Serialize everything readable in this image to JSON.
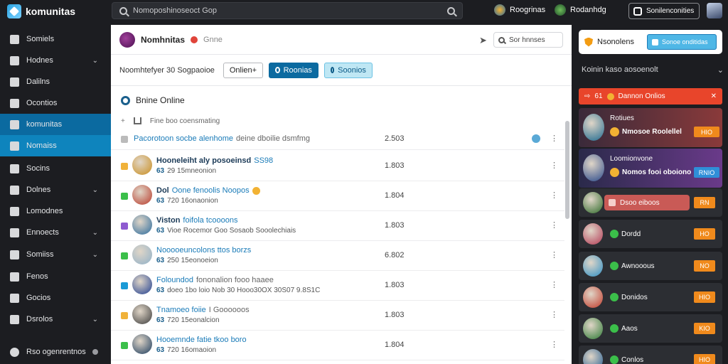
{
  "colors": {
    "accent_blue": "#0b6aa0",
    "orange": "#f08a1c",
    "alert_red": "#e8452b",
    "dark_bg": "#1c1d21"
  },
  "topbar": {
    "brand": "komunitas",
    "search_text": "Nomoposhinoseoct Gop",
    "user1_name": "Roogrinas",
    "user2_name": "Rodanhdg",
    "button_label": "Sonilenconities"
  },
  "sidebar": {
    "items": [
      {
        "label": "Somiels",
        "icon": "grid-icon",
        "chevron": false
      },
      {
        "label": "Hodnes",
        "icon": "globe-icon",
        "chevron": true
      },
      {
        "label": "Dalilns",
        "icon": "book-icon",
        "chevron": false
      },
      {
        "label": "Ocontios",
        "icon": "star-icon",
        "chevron": false
      },
      {
        "label": "komunitas",
        "icon": "community-icon",
        "chevron": false,
        "active": true
      },
      {
        "label": "Nomaiss",
        "icon": "people-icon",
        "chevron": false,
        "active2": true
      },
      {
        "label": "Socins",
        "icon": "user-icon",
        "chevron": false
      },
      {
        "label": "Dolnes",
        "icon": "folder-icon",
        "chevron": true
      },
      {
        "label": "Lomodnes",
        "icon": "group-icon",
        "chevron": false
      },
      {
        "label": "Ennoects",
        "icon": "building-icon",
        "chevron": true
      },
      {
        "label": "Somiiss",
        "icon": "chart-icon",
        "chevron": true
      },
      {
        "label": "Fenos",
        "icon": "list-icon",
        "chevron": false
      },
      {
        "label": "Gocios",
        "icon": "location-icon",
        "chevron": false
      },
      {
        "label": "Dsrolos",
        "icon": "globe-icon",
        "chevron": true
      }
    ],
    "footer": "Rso ogenrentnos"
  },
  "group": {
    "name": "Nomhnitas",
    "sub": "Gnne",
    "search_label": "Sor hnnses"
  },
  "filter": {
    "label": "Noomhtefyer 30 Sogpaoioe",
    "btn_outline": "Onlien+",
    "btn_solid": "Roonias",
    "btn_light": "Soonios"
  },
  "online": {
    "title": "Bnine Online",
    "sub": "Fine boo coensmating"
  },
  "rows": [
    {
      "pinned": true,
      "title_blue": "Pacorotoon socbe alenhome",
      "title_grey": "deine dboilie dsmfmg",
      "num": "2.503",
      "check_color": "#bbbbbb"
    },
    {
      "tag": "Hooneleiht aly posoeinsd",
      "blue": "SS98",
      "id": "63",
      "sub": "29 15mneonion",
      "num": "1.803",
      "check_color": "#f0b23a",
      "av": "#c98d1e"
    },
    {
      "tag": "Dol",
      "blue": "Oone fenoolis Noopos",
      "id": "63",
      "sub": "720 16onaonion",
      "num": "1.804",
      "check_color": "#3bbf4a",
      "av": "#b83a2a"
    },
    {
      "tag": "Viston",
      "blue": "foifola tcoooons",
      "id": "63",
      "sub": "Vioe Rocemor Goo Sosaob Sooolechiais",
      "num": "1.803",
      "check_color": "#8e5bd0",
      "av": "#2a6a9c"
    },
    {
      "tag": "",
      "blue": "Nooooeuncolons ttos borzs",
      "id": "63",
      "sub": "250 15eonoeion",
      "num": "6.802",
      "check_color": "#3bbf4a",
      "av": "#8fb0c8"
    },
    {
      "tag": "",
      "blue": "Foloundod",
      "grey": "fononalion fooo haaee",
      "id": "63",
      "sub": "doeo 1bo loio Nob 30 Hooo30OX 30S07 9.8S1C",
      "num": "1.803",
      "check_color": "#1a9ad6",
      "av": "#1f3e8f"
    },
    {
      "tag": "",
      "blue": "Tnamoeo foiie",
      "grey": "I Goooooos",
      "id": "63",
      "sub": "720 15eonalcion",
      "num": "1.803",
      "check_color": "#f0b23a",
      "av": "#3a3a3a"
    },
    {
      "tag": "",
      "blue": "Hooemnde fatie tkoo boro",
      "id": "63",
      "sub": "720 16omaoion",
      "num": "1.804",
      "check_color": "#3bbf4a",
      "av": "#1a3a5c"
    }
  ],
  "right_panel": {
    "title": "Nsonolens",
    "button": "Sonoe onditidas",
    "section": "Koinin kaso aosoenolt",
    "alert_num": "61",
    "alert_text": "Dannon Onlios",
    "tall_cards": [
      {
        "line1": "Rotiues",
        "line2": "Nmosoe Roolellel",
        "btn": "HIO",
        "blue": false,
        "av": "#1f6a8f"
      },
      {
        "line1": "Loomionvone",
        "line2": "Nomos fooi oboiono",
        "btn": "RNIO",
        "blue": true,
        "av": "#2b4a8a"
      }
    ],
    "cards": [
      {
        "name": "Dsoo eiboos",
        "btn": "RN",
        "pill": true,
        "av": "#2f6a2a"
      },
      {
        "name": "Dordd",
        "btn": "HO",
        "av": "#b23a55"
      },
      {
        "name": "Awnooous",
        "btn": "NO",
        "av": "#2e8fc4"
      },
      {
        "name": "Donidos",
        "btn": "HIO",
        "av": "#c13a2a"
      },
      {
        "name": "Aaos",
        "btn": "KIO",
        "av": "#2e7a35"
      },
      {
        "name": "Conlos",
        "btn": "HIO",
        "av": "#1f5a8f"
      }
    ]
  }
}
